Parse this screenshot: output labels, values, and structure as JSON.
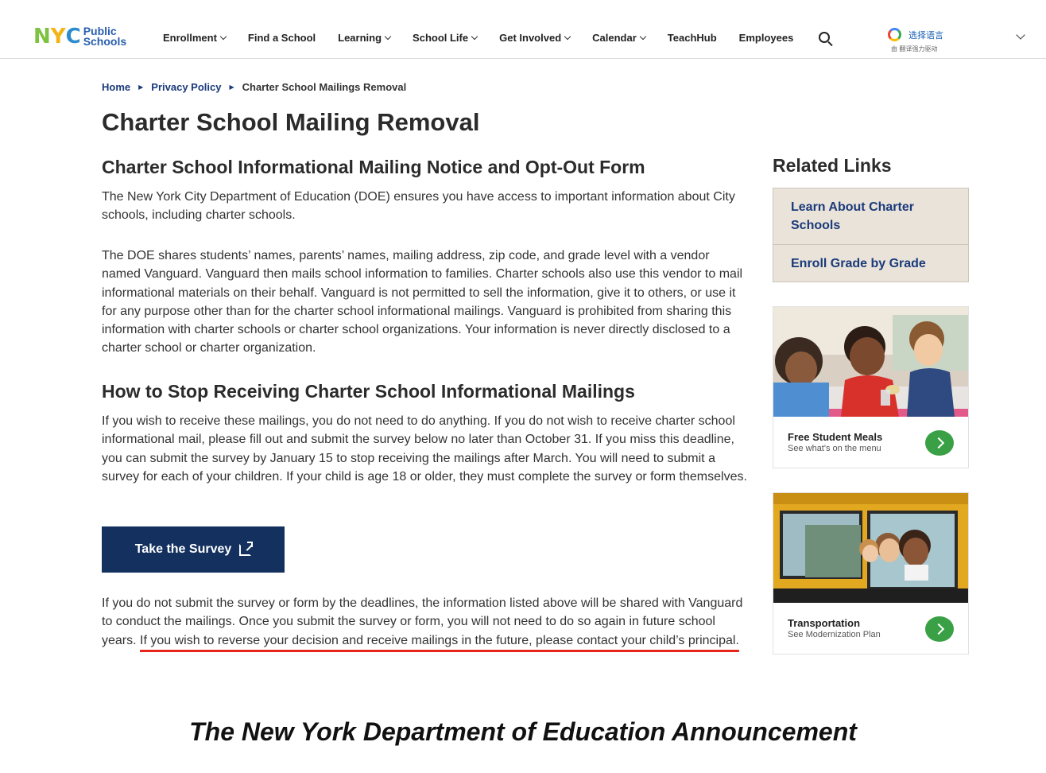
{
  "header": {
    "logo": {
      "nyc": [
        "N",
        "Y",
        "C"
      ],
      "line1": "Public",
      "line2": "Schools"
    },
    "nav": [
      {
        "label": "Enrollment",
        "dropdown": true
      },
      {
        "label": "Find a School",
        "dropdown": false
      },
      {
        "label": "Learning",
        "dropdown": true
      },
      {
        "label": "School Life",
        "dropdown": true
      },
      {
        "label": "Get Involved",
        "dropdown": true
      },
      {
        "label": "Calendar",
        "dropdown": true
      },
      {
        "label": "TeachHub",
        "dropdown": false
      },
      {
        "label": "Employees",
        "dropdown": false
      }
    ],
    "search_icon": "search-icon",
    "translate": {
      "label": "选择语言",
      "powered_by": "由 翻译强力驱动"
    }
  },
  "breadcrumb": [
    {
      "label": "Home"
    },
    {
      "label": "Privacy Policy"
    },
    {
      "label": "Charter School Mailings Removal"
    }
  ],
  "page_title": "Charter School Mailing Removal",
  "section1": {
    "heading": "Charter School Informational Mailing Notice and Opt-Out Form",
    "p1": "The New York City Department of Education (DOE) ensures you have access to important information about City schools, including charter schools.",
    "p2": "The DOE shares students’ names, parents’ names, mailing address, zip code, and grade level with a vendor named Vanguard. Vanguard then mails school information to families. Charter schools also use this vendor to mail informational materials on their behalf. Vanguard is not permitted to sell the information, give it to others, or use it for any purpose other than for the charter school informational mailings. Vanguard is prohibited from sharing this information with charter schools or charter school organizations. Your information is never directly disclosed to a charter school or charter organization."
  },
  "section2": {
    "heading": "How to Stop Receiving Charter School Informational Mailings",
    "p1": "If you wish to receive these mailings, you do not need to do anything. If you do not wish to receive charter school informational mail, please fill out and submit the survey below no later than October 31. If you miss this deadline, you can submit the survey by January 15 to stop receiving the mailings after March. You will need to submit a survey for each of your children. If your child is age 18 or older, they must complete the survey or form themselves.",
    "button_label": "Take the Survey",
    "p2_start": "If you do not submit the survey or form by the deadlines, the information listed above will be shared with Vanguard to conduct the mailings. Once you submit the survey or form, you will not need to do so again in future school years. ",
    "p2_highlight": "If you wish to reverse your decision and receive mailings in the future, please contact your child’s principal.",
    "highlight_color": "#e8251b"
  },
  "sidebar": {
    "heading": "Related Links",
    "links": [
      "Learn About Charter Schools",
      "Enroll Grade by Grade"
    ],
    "cards": [
      {
        "title": "Free Student Meals",
        "subtitle": "See what's on the menu"
      },
      {
        "title": "Transportation",
        "subtitle": "See Modernization Plan"
      }
    ]
  },
  "caption": "The New York Department of Education Announcement",
  "colors": {
    "brand_navy": "#13305f",
    "link": "#1a3a7a",
    "arrow_green": "#3aa046",
    "related_bg": "#e9e3da"
  }
}
